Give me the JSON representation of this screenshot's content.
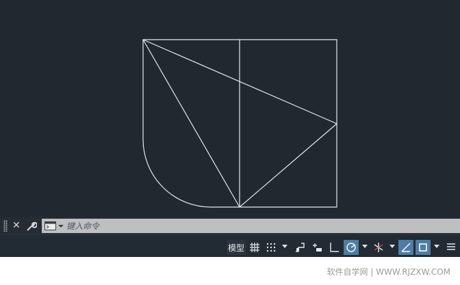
{
  "command_line": {
    "placeholder": "键入命令",
    "icons": [
      "grip-handle",
      "close-icon",
      "wrench-icon",
      "command-prompt-icon",
      "chevron-down-icon"
    ]
  },
  "status_bar": {
    "model_label": "模型",
    "buttons": [
      "grid-icon",
      "snap-icon",
      "infer-constraints-icon",
      "dynamic-input-icon",
      "ortho-icon",
      "polar-tracking-icon",
      "isodraft-icon",
      "object-snap-tracking-icon",
      "object-snap-icon",
      "customization-icon"
    ]
  },
  "colors": {
    "drawing_background": "#212830",
    "line": "#e8ebee",
    "active_button": "#4e7da6"
  },
  "watermark": "软件自学网 | WWW.RJZXW.COM"
}
